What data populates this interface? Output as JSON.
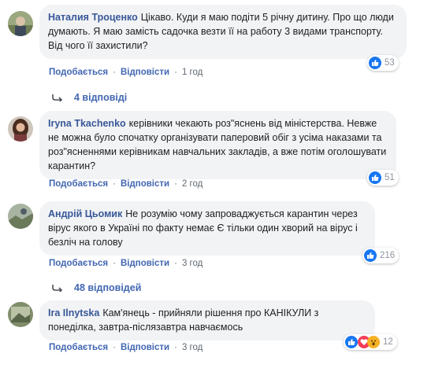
{
  "comments": [
    {
      "author": "Наталия Троценко",
      "text": "Цікаво. Куди я маю подіти 5 річну дитину. Про що люди думають. Я маю замість садочка везти її на работу 3 видами транспорту. Від чого її захистили?",
      "like_label": "Подобається",
      "reply_label": "Відповісти",
      "time": "1 год",
      "reactions_count": "53",
      "replies_label": "4 відповіді"
    },
    {
      "author": "Iryna Tkachenko",
      "text": "керівники чекають роз\"яснень від міністерства. Невже не можна було спочатку організувати паперовий обіг з усіма наказами та роз\"ясненнями керівникам навчальних закладів, а вже потім оголошувати карантин?",
      "like_label": "Подобається",
      "reply_label": "Відповісти",
      "time": "2 год",
      "reactions_count": "51"
    },
    {
      "author": "Андрій Цьомик",
      "text": "Не розумію чому запроваджується карантин через вірус якого в Україні по факту немає Є тільки один хворий на вірус і безліч на голову",
      "like_label": "Подобається",
      "reply_label": "Відповісти",
      "time": "3 год",
      "reactions_count": "216",
      "replies_label": "48 відповідей"
    },
    {
      "author": "Ira Ilnytska",
      "text": "Кам'янець - прийняли рішення про КАНІКУЛИ з понеділка, завтра-післязавтра навчаємось",
      "like_label": "Подобається",
      "reply_label": "Відповісти",
      "time": "3 год",
      "reactions_count": "12"
    }
  ],
  "colors": {
    "link": "#4267b2",
    "author": "#385898",
    "bubble": "#f2f3f5",
    "like": "#1877f2",
    "love": "#f33e58",
    "wow": "#f7b125"
  }
}
